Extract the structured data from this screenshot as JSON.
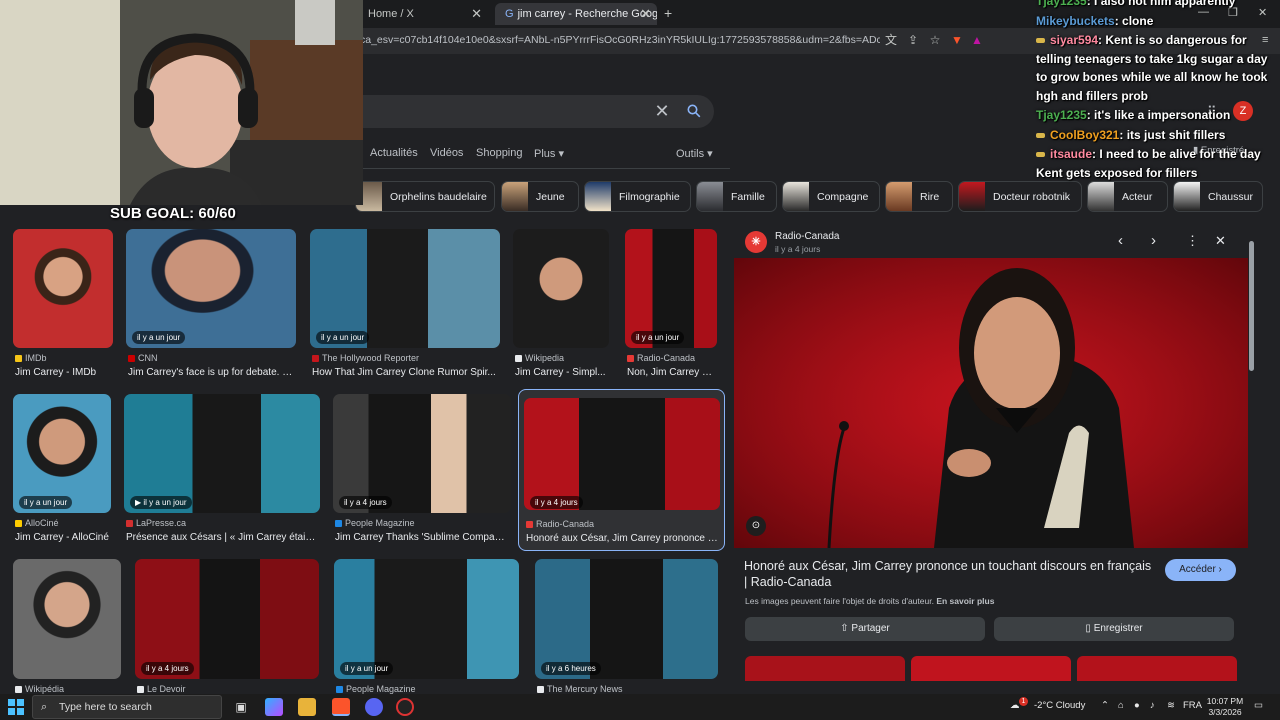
{
  "browser": {
    "tabs": [
      {
        "title": "Home / X",
        "active": false
      },
      {
        "title": "jim carrey - Recherche Google",
        "active": true
      }
    ],
    "new_tab_label": "+",
    "url": "ca_esv=c07cb14f104e10e0&sxsrf=ANbL-n5PYrrrFisOcG0RHz3inYR5kIULIg:1772593578858&udm=2&fbs=ADc_l-bpk8W4E..."
  },
  "search": {
    "clear_glyph": "✕",
    "filters": [
      "Actualités",
      "Vidéos",
      "Shopping",
      "Plus ▾"
    ],
    "tools": "Outils ▾",
    "saved": "Enregistré"
  },
  "chips": [
    "Orphelins baudelaire",
    "Jeune",
    "Filmographie",
    "Famille",
    "Compagne",
    "Rire",
    "Docteur robotnik",
    "Acteur",
    "Chaussur"
  ],
  "results": {
    "row1": [
      {
        "badge": "",
        "source": "IMDb",
        "title": "Jim Carrey - IMDb",
        "color": "#f5c518"
      },
      {
        "badge": "il y a un jour",
        "source": "CNN",
        "title": "Jim Carrey's face is up for debate. N...",
        "color": "#cc0000"
      },
      {
        "badge": "il y a un jour",
        "source": "The Hollywood Reporter",
        "title": "How That Jim Carrey Clone Rumor Spir...",
        "color": "#c4161c"
      },
      {
        "badge": "",
        "source": "Wikipedia",
        "title": "Jim Carrey - Simpl...",
        "color": "#e8eaed"
      },
      {
        "badge": "il y a un jour",
        "source": "Radio-Canada",
        "title": "Non, Jim Carrey n'...",
        "color": "#e53935"
      }
    ],
    "row2": [
      {
        "badge": "il y a un jour",
        "source": "AlloCiné",
        "title": "Jim Carrey - AlloCiné",
        "color": "#fecc00"
      },
      {
        "badge": "▶ il y a un jour",
        "source": "LaPresse.ca",
        "title": "Présence aux Césars | « Jim Carrey était ...",
        "color": "#d32f2f"
      },
      {
        "badge": "il y a 4 jours",
        "source": "People Magazine",
        "title": "Jim Carrey Thanks 'Sublime Compani...",
        "color": "#1e88e5"
      },
      {
        "badge": "il y a 4 jours",
        "source": "Radio-Canada",
        "title": "Honoré aux César, Jim Carrey prononce u...",
        "color": "#e53935"
      }
    ],
    "row3": [
      {
        "badge": "",
        "source": "Wikipédia"
      },
      {
        "badge": "il y a 4 jours",
        "source": "Le Devoir"
      },
      {
        "badge": "il y a un jour",
        "source": "People Magazine"
      },
      {
        "badge": "il y a 6 heures",
        "source": "The Mercury News"
      }
    ]
  },
  "panel": {
    "source": "Radio-Canada",
    "time": "il y a 4 jours",
    "title": "Honoré aux César, Jim Carrey prononce un touchant discours en français | Radio-Canada",
    "rights": "Les images peuvent faire l'objet de droits d'auteur.",
    "learn_more": "En savoir plus",
    "visit": "Accéder ›",
    "share": "Partager",
    "save": "Enregistrer"
  },
  "overlay": {
    "subgoal": "SUB GOAL: 60/60",
    "chat": [
      {
        "user": "Tjay1235",
        "text": ": I also not him apparently",
        "color": "#4caf50",
        "badge": false
      },
      {
        "user": "Mikeybuckets",
        "text": ": clone",
        "color": "#5b9bd5",
        "badge": false
      },
      {
        "user": "siyar594",
        "text": ": Kent is so dangerous for telling teenagers to take 1kg sugar a day to grow bones while we all know he took hgh and fillers prob",
        "color": "#ff8aa0",
        "badge": true
      },
      {
        "user": "Tjay1235",
        "text": ": it's like a impersonation",
        "color": "#4caf50",
        "badge": false
      },
      {
        "user": "CoolBoy321",
        "text": ": its just shit fillers",
        "color": "#f0a020",
        "badge": true
      },
      {
        "user": "itsaude",
        "text": ": I need to be alive for the day Kent gets exposed for fillers",
        "color": "#ff8aa0",
        "badge": true
      }
    ]
  },
  "taskbar": {
    "search_placeholder": "Type here to search",
    "weather": "-2°C  Cloudy",
    "lang": "FRA",
    "time": "10:07 PM",
    "date": "3/3/2026",
    "notif": "1"
  },
  "colors": {
    "page_bg": "#202124",
    "accent": "#8ab4f8",
    "visit_btn": "#8ab4f8",
    "photo_red": "#b3121b"
  }
}
